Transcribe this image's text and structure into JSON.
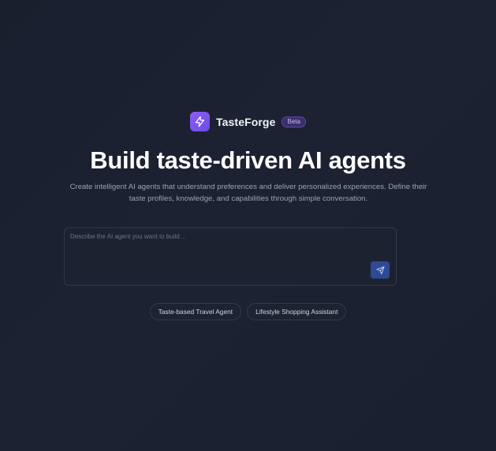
{
  "brand": {
    "name": "TasteForge",
    "badge": "Beta",
    "logo_icon": "lightning-bolt-icon",
    "accent_color": "#8b5cf6"
  },
  "hero": {
    "headline": "Build taste-driven AI agents",
    "subtitle": "Create intelligent AI agents that understand preferences and deliver personalized experiences. Define their taste profiles, knowledge, and capabilities through simple conversation."
  },
  "composer": {
    "placeholder": "Describe the AI agent you want to build...",
    "value": "",
    "send_icon": "send-icon",
    "send_button_color": "#2f4a94"
  },
  "suggestions": [
    {
      "label": "Taste-based Travel Agent"
    },
    {
      "label": "Lifestyle Shopping Assistant"
    }
  ]
}
